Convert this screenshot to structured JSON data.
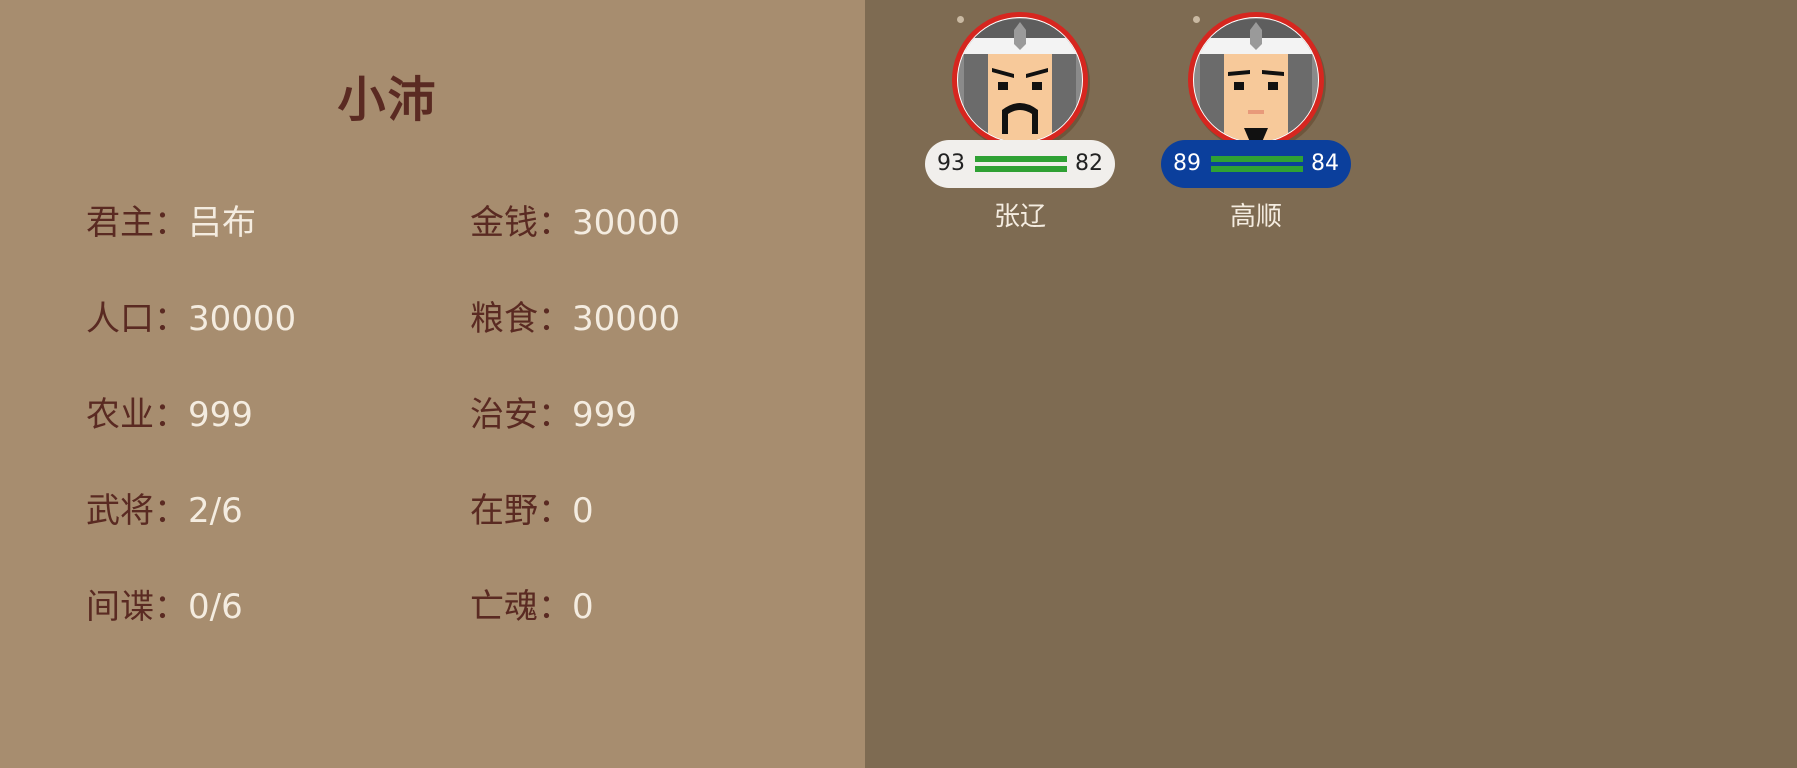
{
  "city": {
    "name": "小沛"
  },
  "stats": {
    "ruler": {
      "label": "君主：",
      "value": "吕布"
    },
    "money": {
      "label": "金钱：",
      "value": "30000"
    },
    "population": {
      "label": "人口：",
      "value": "30000"
    },
    "food": {
      "label": "粮食：",
      "value": "30000"
    },
    "agriculture": {
      "label": "农业：",
      "value": "999"
    },
    "security": {
      "label": "治安：",
      "value": "999"
    },
    "generals": {
      "label": "武将：",
      "value": "2/6"
    },
    "unemployed": {
      "label": "在野：",
      "value": "0"
    },
    "spies": {
      "label": "间谍：",
      "value": "0/6"
    },
    "souls": {
      "label": "亡魂：",
      "value": "0"
    }
  },
  "generals": [
    {
      "name": "张辽",
      "stat_left": "93",
      "stat_right": "82",
      "pill_color": "#f1efec"
    },
    {
      "name": "高顺",
      "stat_left": "89",
      "stat_right": "84",
      "pill_color": "#0b3f9c"
    }
  ],
  "colors": {
    "left_bg": "#a78d6f",
    "right_bg": "#7e6b52",
    "label": "#5a2a22",
    "value": "#f4ece0",
    "portrait_ring": "#d6261f",
    "bar": "#2fa134"
  }
}
